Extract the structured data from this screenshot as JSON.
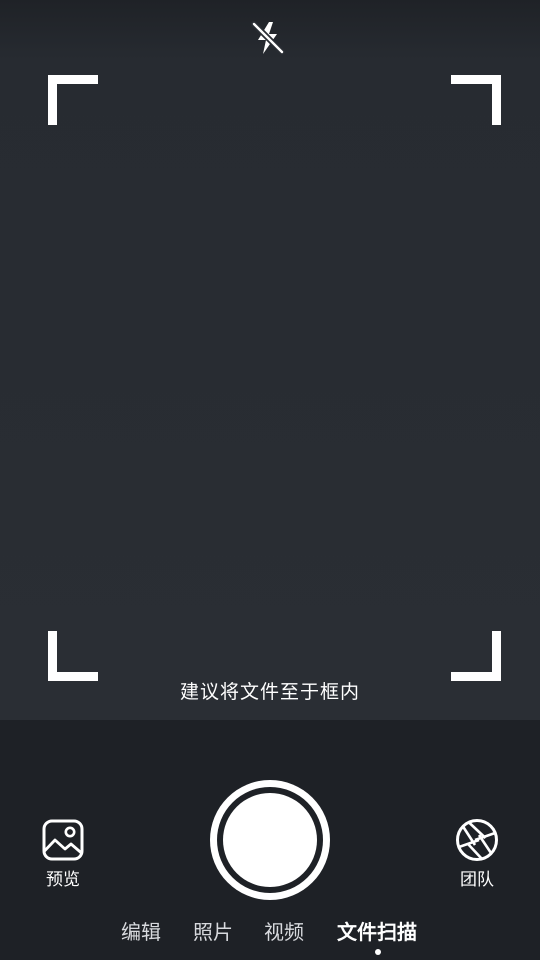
{
  "camera": {
    "hint": "建议将文件至于框内",
    "flash_icon": "flash-off-icon"
  },
  "bottom_bar": {
    "preview_label": "预览",
    "team_label": "团队",
    "preview_icon": "gallery-image-icon",
    "team_icon": "aperture-icon"
  },
  "modes": [
    {
      "label": "编辑",
      "active": false
    },
    {
      "label": "照片",
      "active": false
    },
    {
      "label": "视频",
      "active": false
    },
    {
      "label": "文件扫描",
      "active": true
    }
  ],
  "colors": {
    "background": "#1e2126",
    "viewfinder": "#2a2e34",
    "accent": "#ffffff"
  }
}
